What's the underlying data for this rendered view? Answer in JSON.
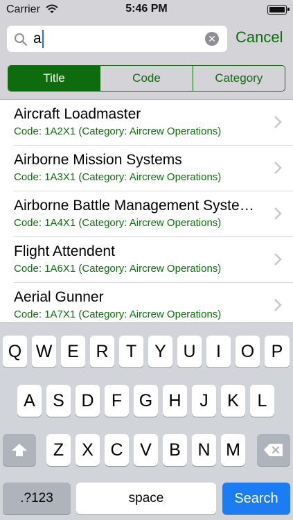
{
  "status_bar": {
    "carrier": "Carrier",
    "time": "5:46 PM"
  },
  "search": {
    "query": "a",
    "cancel_label": "Cancel",
    "clear_icon": "clear-icon",
    "search_icon": "magnifying-glass-icon"
  },
  "segments": [
    {
      "label": "Title",
      "selected": true
    },
    {
      "label": "Code",
      "selected": false
    },
    {
      "label": "Category",
      "selected": false
    }
  ],
  "results": [
    {
      "title": "Aircraft Loadmaster",
      "subtitle": "Code: 1A2X1 (Category: Aircrew Operations)"
    },
    {
      "title": "Airborne Mission Systems",
      "subtitle": "Code: 1A3X1 (Category: Aircrew Operations)"
    },
    {
      "title": "Airborne Battle Management Systems",
      "subtitle": "Code: 1A4X1 (Category: Aircrew Operations)"
    },
    {
      "title": "Flight Attendent",
      "subtitle": "Code: 1A6X1 (Category: Aircrew Operations)"
    },
    {
      "title": "Aerial Gunner",
      "subtitle": "Code: 1A7X1 (Category: Aircrew Operations)"
    }
  ],
  "keyboard": {
    "row1": [
      "Q",
      "W",
      "E",
      "R",
      "T",
      "Y",
      "U",
      "I",
      "O",
      "P"
    ],
    "row2": [
      "A",
      "S",
      "D",
      "F",
      "G",
      "H",
      "J",
      "K",
      "L"
    ],
    "row3": [
      "Z",
      "X",
      "C",
      "V",
      "B",
      "N",
      "M"
    ],
    "numbers_label": ".?123",
    "space_label": "space",
    "search_label": "Search",
    "shift_icon": "shift-arrow-icon",
    "delete_icon": "backspace-icon"
  },
  "colors": {
    "accent": "#0e6b0e",
    "search_key": "#1c7cf4"
  }
}
